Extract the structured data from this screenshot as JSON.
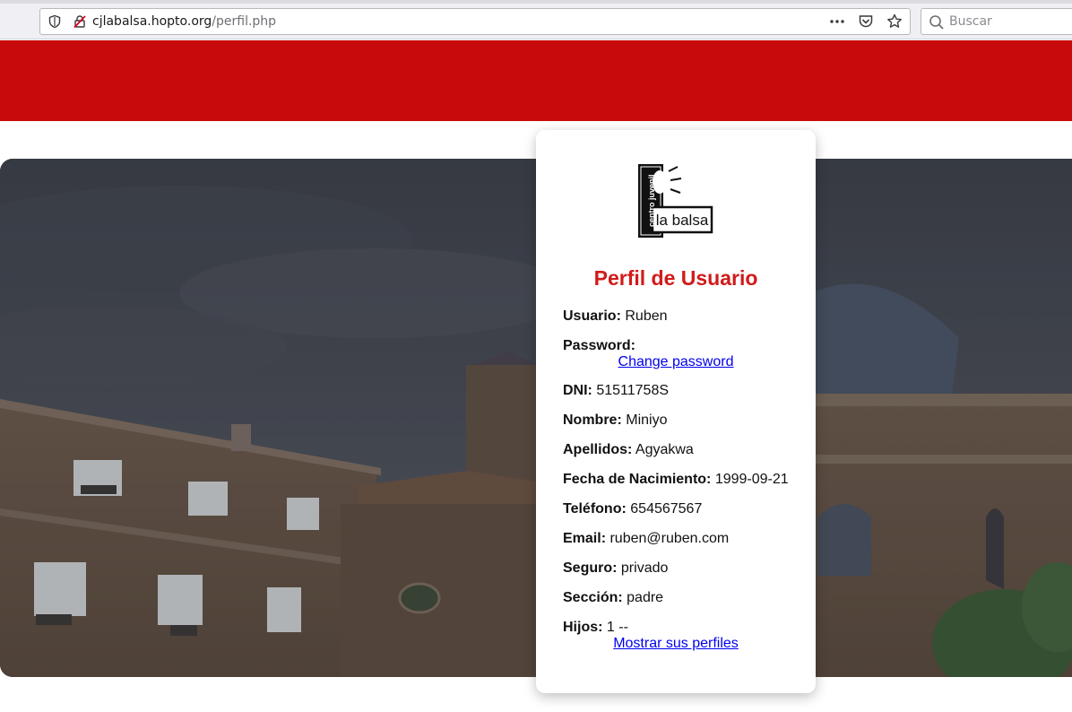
{
  "browser": {
    "url_host": "cjlabalsa.hopto.org",
    "url_path": "/perfil.php",
    "search_placeholder": "Buscar"
  },
  "colors": {
    "header_red": "#c80a0a",
    "title_red": "#d11a1a",
    "link_blue": "#0000ee"
  },
  "logo": {
    "vertical_text": "centro juvenil",
    "text": "la balsa"
  },
  "profile": {
    "title": "Perfil de Usuario",
    "usuario_label": "Usuario:",
    "usuario_value": "Ruben",
    "password_label": "Password:",
    "change_password_link": "Change password",
    "dni_label": "DNI:",
    "dni_value": "51511758S",
    "nombre_label": "Nombre:",
    "nombre_value": "Miniyo",
    "apellidos_label": "Apellidos:",
    "apellidos_value": "Agyakwa",
    "fecha_label": "Fecha de Nacimiento:",
    "fecha_value": "1999-09-21",
    "telefono_label": "Teléfono:",
    "telefono_value": "654567567",
    "email_label": "Email:",
    "email_value": "ruben@ruben.com",
    "seguro_label": "Seguro:",
    "seguro_value": "privado",
    "seccion_label": "Sección:",
    "seccion_value": "padre",
    "hijos_label": "Hijos:",
    "hijos_value": "1 --",
    "mostrar_link": "Mostrar sus perfiles"
  },
  "icons": [
    "shield-icon",
    "insecure-lock-icon",
    "more-icon",
    "pocket-icon",
    "bookmark-star-icon",
    "search-icon"
  ]
}
